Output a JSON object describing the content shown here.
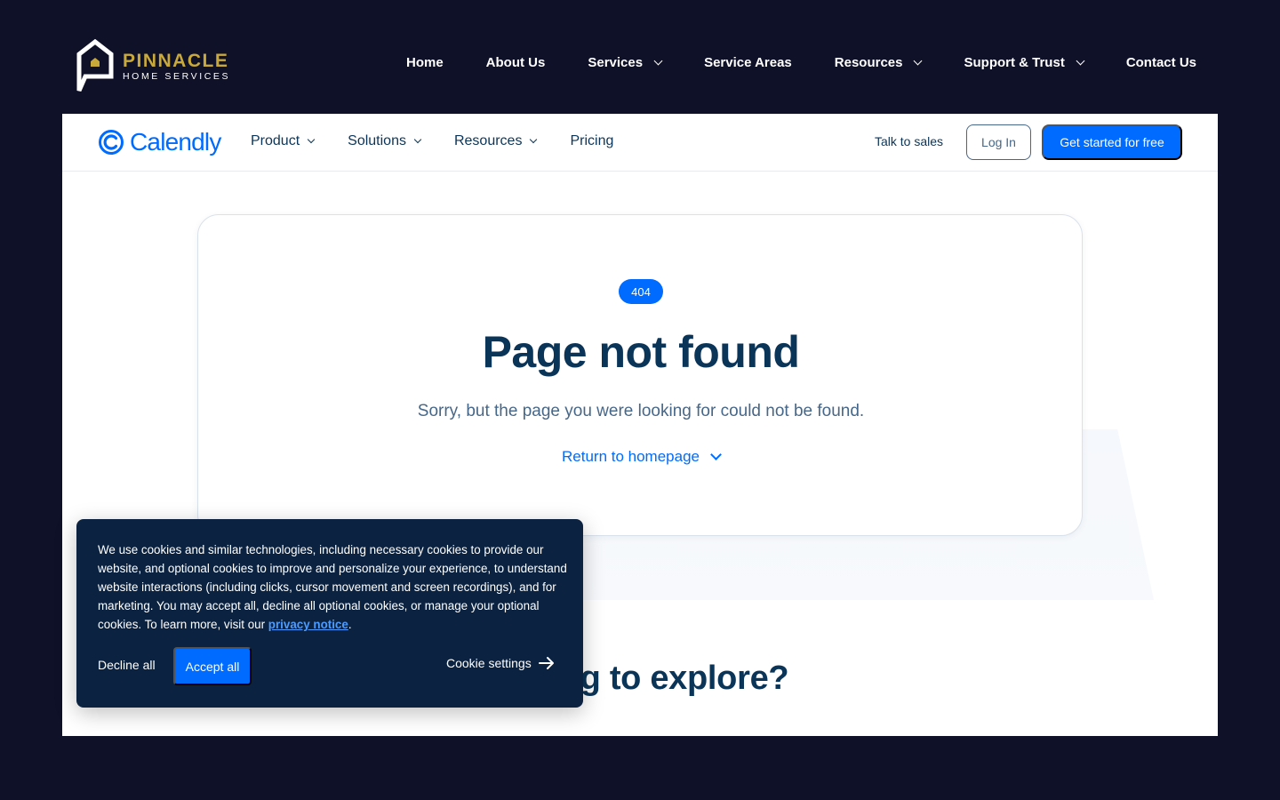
{
  "site": {
    "logo": {
      "name": "PINNACLE",
      "tagline": "HOME SERVICES"
    },
    "nav": [
      {
        "label": "Home",
        "dropdown": false
      },
      {
        "label": "About Us",
        "dropdown": false
      },
      {
        "label": "Services",
        "dropdown": true
      },
      {
        "label": "Service Areas",
        "dropdown": false
      },
      {
        "label": "Resources",
        "dropdown": true
      },
      {
        "label": "Support & Trust",
        "dropdown": true
      },
      {
        "label": "Contact Us",
        "dropdown": false
      }
    ]
  },
  "calendly": {
    "logo_text": "Calendly",
    "menu": [
      {
        "label": "Product",
        "dropdown": true
      },
      {
        "label": "Solutions",
        "dropdown": true
      },
      {
        "label": "Resources",
        "dropdown": true
      },
      {
        "label": "Pricing",
        "dropdown": false
      }
    ],
    "talk_to_sales": "Talk to sales",
    "login": "Log In",
    "get_started": "Get started for free"
  },
  "error": {
    "badge": "404",
    "title": "Page not found",
    "message": "Sorry, but the page you were looking for could not be found.",
    "return_link": "Return to homepage"
  },
  "explore": {
    "heading_visible": "g to explore?"
  },
  "cookie": {
    "text": "We use cookies and similar technologies, including necessary cookies to provide our website, and optional cookies to improve and personalize your experience, to understand website interactions (including clicks, cursor movement and screen recordings), and for marketing. You may accept all, decline all optional cookies, or manage your optional cookies. To learn more, visit our ",
    "privacy_link": "privacy notice",
    "period": ".",
    "decline": "Decline all",
    "accept": "Accept all",
    "settings": "Cookie settings"
  },
  "colors": {
    "page_bg": "#0f1128",
    "brand_gold": "#c9a93a",
    "calendly_blue": "#006bff",
    "navy_text": "#0b3558",
    "cookie_bg": "#0b2341"
  }
}
